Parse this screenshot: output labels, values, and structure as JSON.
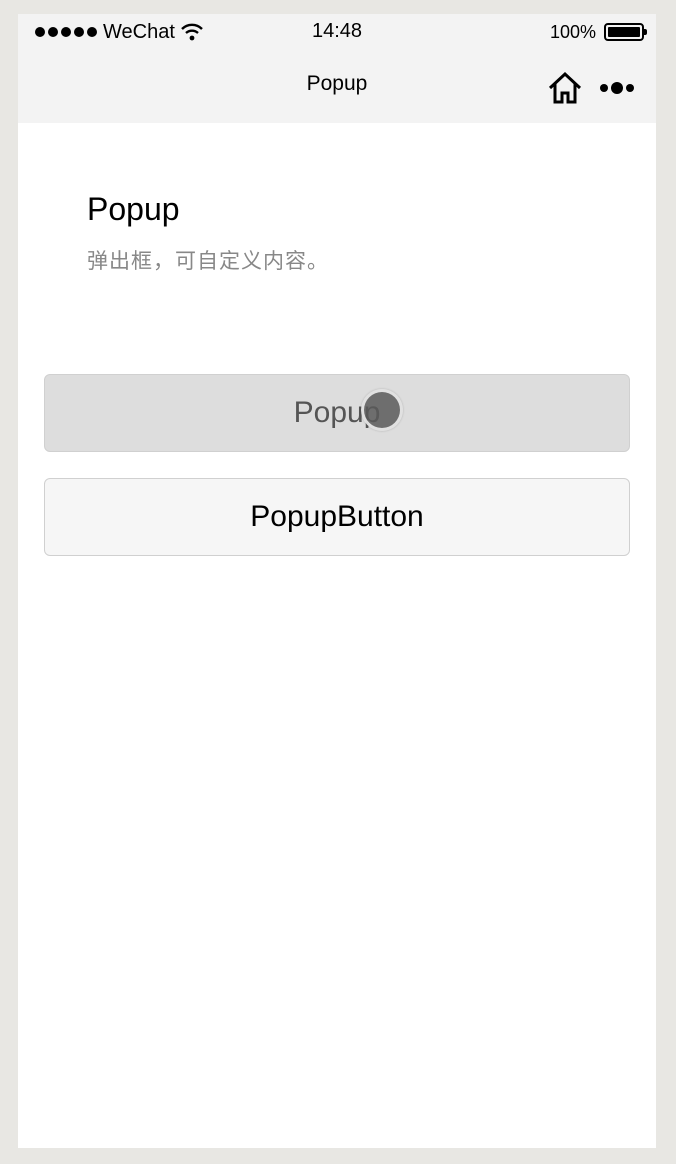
{
  "statusbar": {
    "carrier": "WeChat",
    "time": "14:48",
    "battery_percent": "100%",
    "battery_level": 1.0
  },
  "navbar": {
    "title": "Popup",
    "home_icon": "home-icon",
    "more_icon": "more-dots-icon"
  },
  "page": {
    "title": "Popup",
    "description": "弹出框，可自定义内容。"
  },
  "buttons": {
    "popup_label": "Popup",
    "popupbutton_label": "PopupButton"
  }
}
